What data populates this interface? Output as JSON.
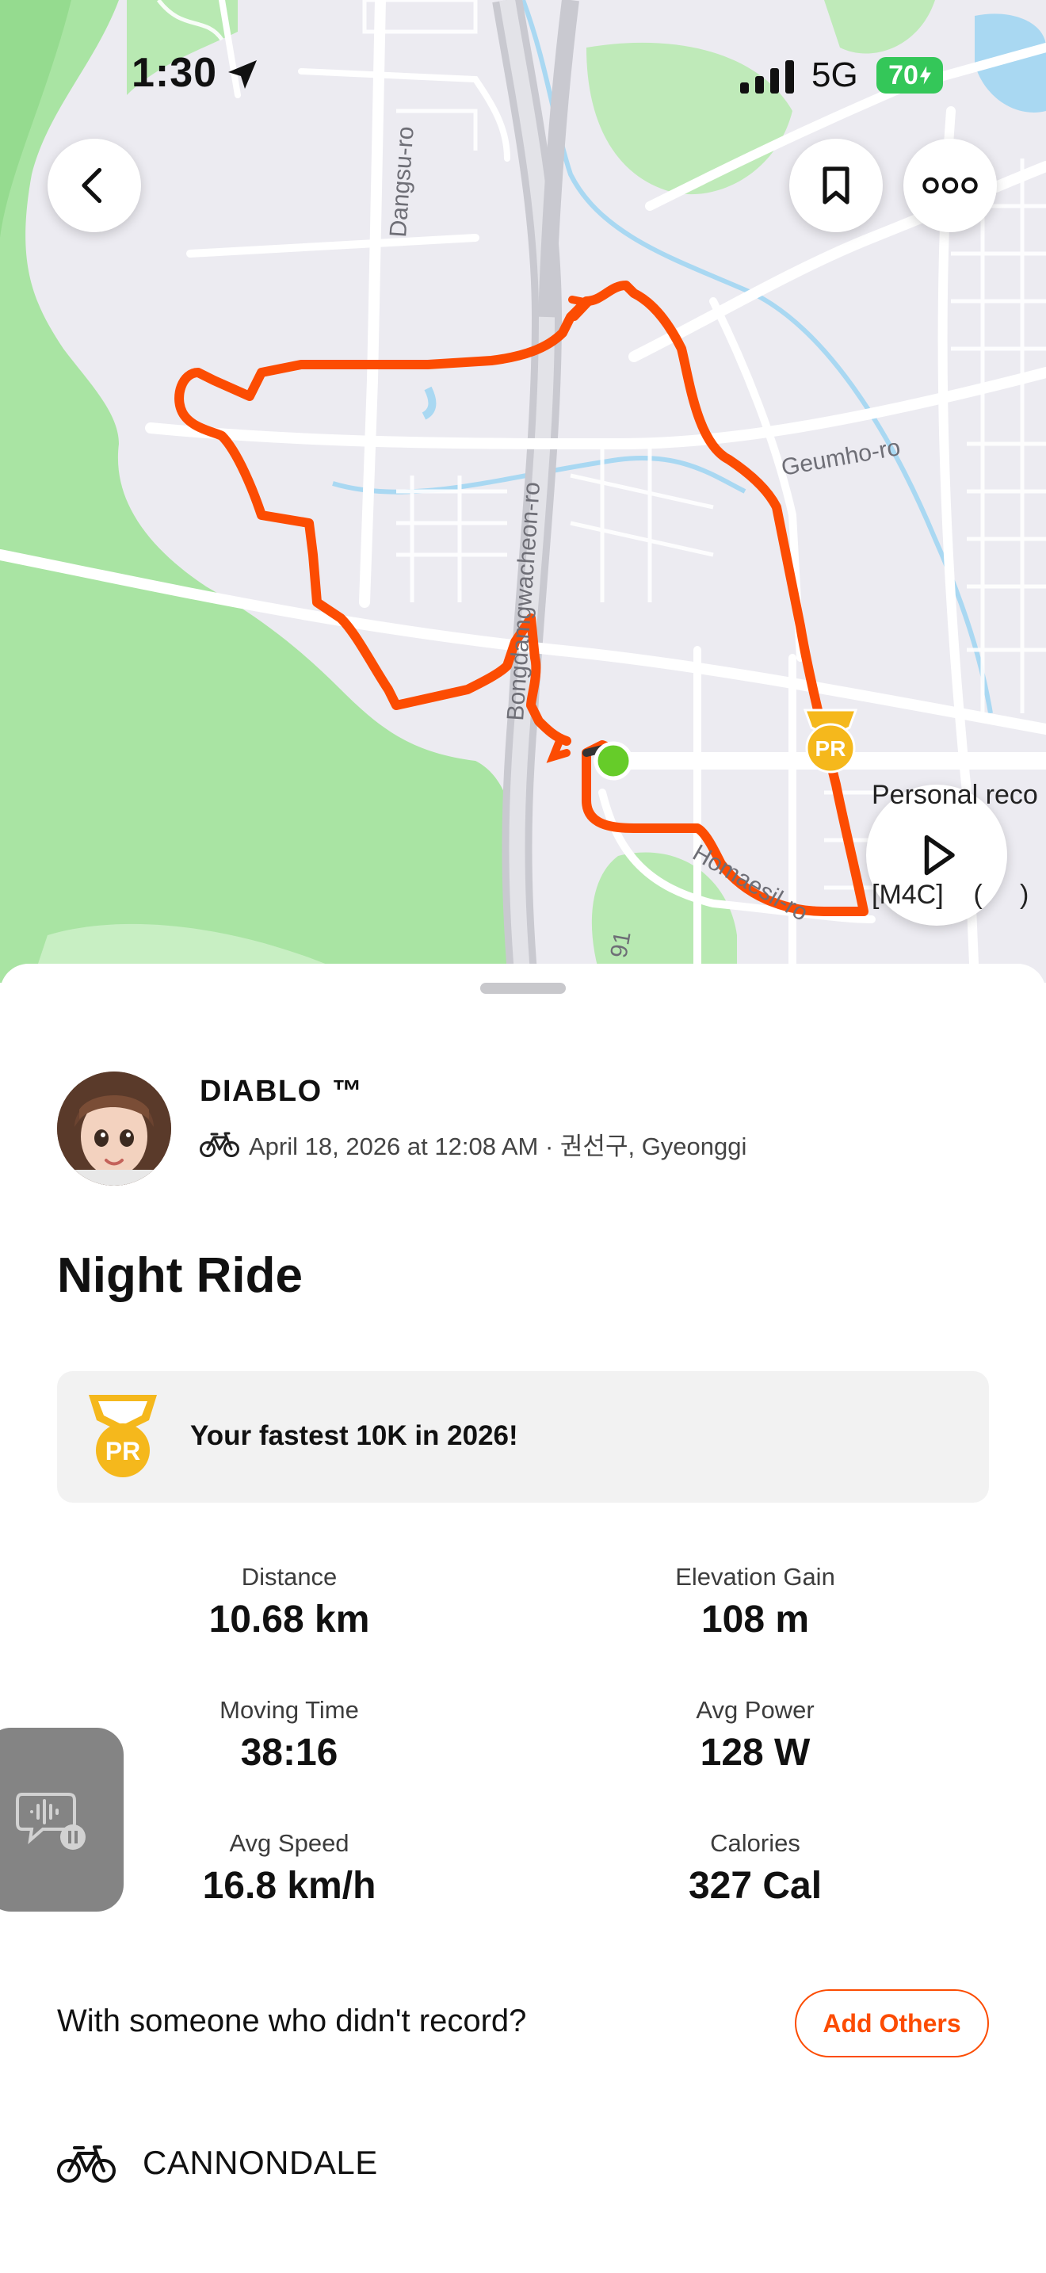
{
  "status_bar": {
    "time": "1:30",
    "network": "5G",
    "battery": "70"
  },
  "map": {
    "road_labels": {
      "dangsu": "Dangsu-ro",
      "bongdam": "Bongdamgwacheon-ro",
      "geumho": "Geumho-ro",
      "homaesil": "Homaesil-ro",
      "route91": "91"
    },
    "pr_label_line1": "Personal reco",
    "pr_label_line2": "[M4C]    (     )",
    "pr_badge": "PR"
  },
  "activity": {
    "athlete_name": "DIABLO ™",
    "meta": "April 18, 2026 at 12:08 AM · 권선구, Gyeonggi",
    "title": "Night Ride"
  },
  "achievement": {
    "badge": "PR",
    "text": "Your fastest 10K in 2026!"
  },
  "stats": {
    "distance": {
      "label": "Distance",
      "value": "10.68 km"
    },
    "elevation": {
      "label": "Elevation Gain",
      "value": "108 m"
    },
    "moving_time": {
      "label": "Moving Time",
      "value": "38:16"
    },
    "avg_power": {
      "label": "Avg Power",
      "value": "128 W"
    },
    "avg_speed": {
      "label": "Avg Speed",
      "value": "16.8 km/h"
    },
    "calories": {
      "label": "Calories",
      "value": "327 Cal"
    }
  },
  "with_others": {
    "prompt": "With someone who didn't record?",
    "button": "Add Others"
  },
  "gear": {
    "name": "CANNONDALE"
  },
  "colors": {
    "accent": "#fc4c02",
    "route": "#fc4c02",
    "park": "#a9e4a3",
    "water": "#a9d8f2",
    "pr_gold": "#f5b81c"
  },
  "icons": [
    "location-arrow-icon",
    "back-chevron-icon",
    "bookmark-icon",
    "more-dots-icon",
    "play-icon",
    "bike-icon",
    "pr-medal-icon",
    "voice-memo-icon"
  ]
}
